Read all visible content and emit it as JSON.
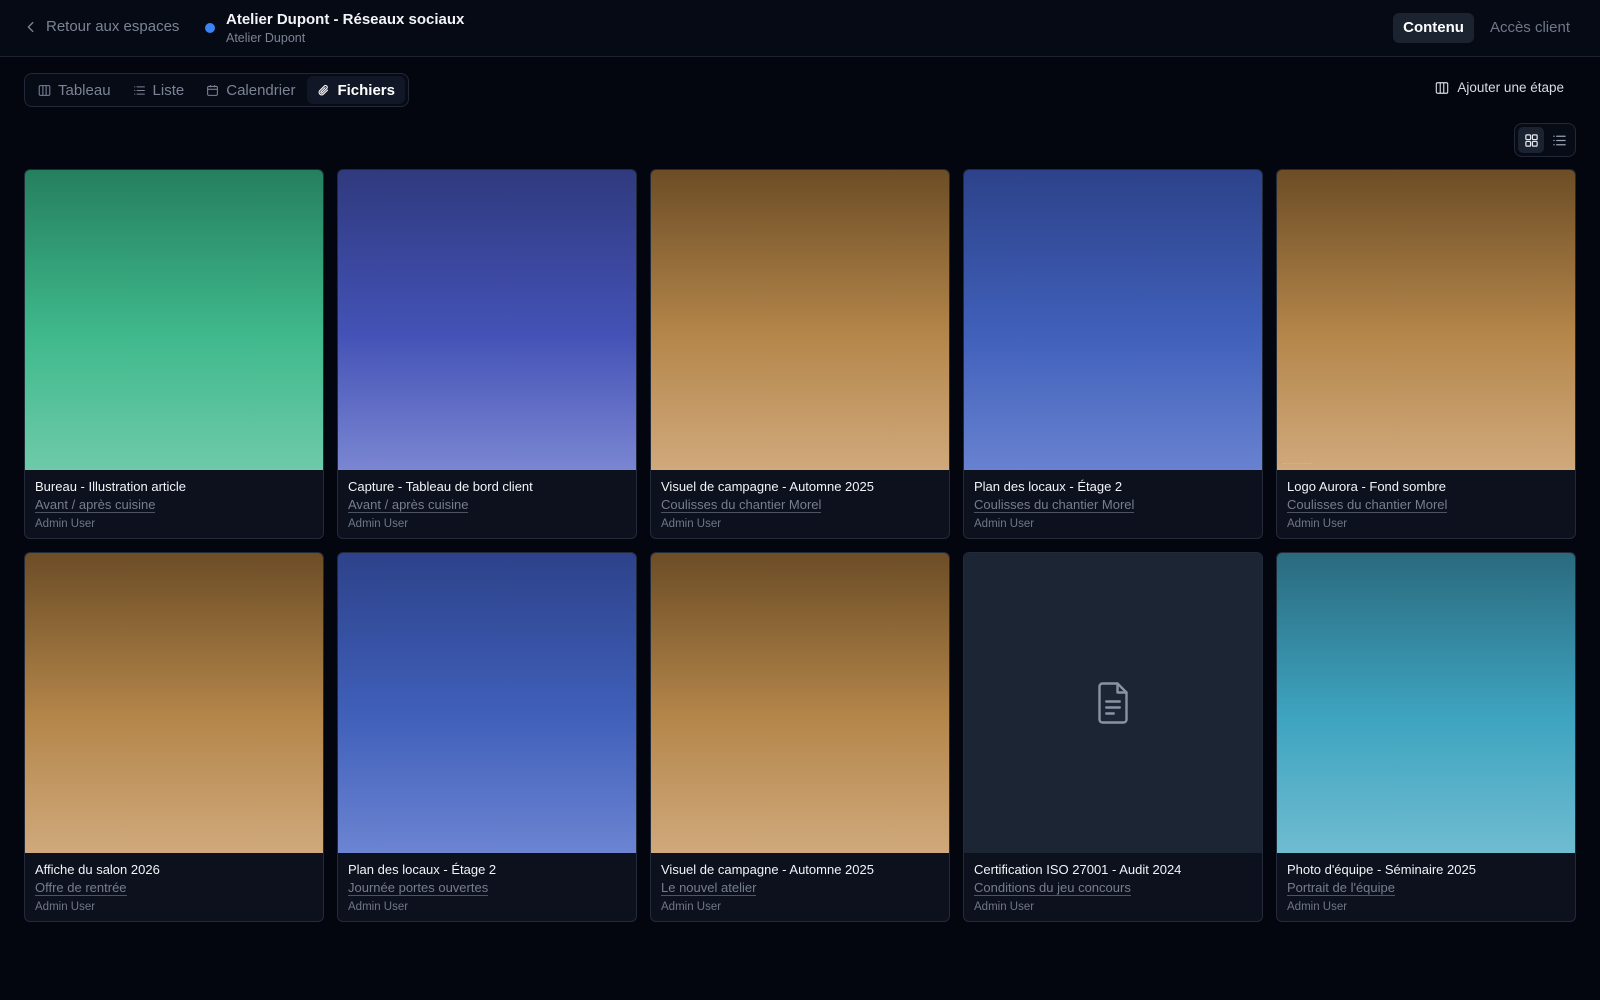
{
  "header": {
    "back_label": "Retour aux espaces",
    "space_title": "Atelier Dupont - Réseaux sociaux",
    "space_subtitle": "Atelier Dupont",
    "space_color": "#3b82f6",
    "modes": [
      {
        "label": "Contenu",
        "active": true
      },
      {
        "label": "Accès client",
        "active": false
      }
    ]
  },
  "tabs": [
    {
      "label": "Tableau",
      "icon": "columns-icon",
      "active": false
    },
    {
      "label": "Liste",
      "icon": "list-icon",
      "active": false
    },
    {
      "label": "Calendrier",
      "icon": "calendar-icon",
      "active": false
    },
    {
      "label": "Fichiers",
      "icon": "paperclip-icon",
      "active": true
    }
  ],
  "toolbar": {
    "add_step_label": "Ajouter une étape",
    "view_mode": "grid"
  },
  "files": [
    {
      "title": "Bureau - Illustration article",
      "step": "Avant / après cuisine",
      "author": "Admin User",
      "preview": "image",
      "gradient": [
        "#257f5e",
        "#3fb98c",
        "#6ecaa9"
      ]
    },
    {
      "title": "Capture - Tableau de bord client",
      "step": "Avant / après cuisine",
      "author": "Admin User",
      "preview": "image",
      "gradient": [
        "#2f3a7e",
        "#4452b6",
        "#7a86d2"
      ]
    },
    {
      "title": "Visuel de campagne - Automne 2025",
      "step": "Coulisses du chantier Morel",
      "author": "Admin User",
      "preview": "image",
      "gradient": [
        "#6c4d26",
        "#b4864a",
        "#d0a97c"
      ]
    },
    {
      "title": "Plan des locaux - Étage 2",
      "step": "Coulisses du chantier Morel",
      "author": "Admin User",
      "preview": "image",
      "gradient": [
        "#2d428a",
        "#4060ba",
        "#6882d0"
      ]
    },
    {
      "title": "Logo Aurora - Fond sombre",
      "step": "Coulisses du chantier Morel",
      "author": "Admin User",
      "preview": "image",
      "gradient": [
        "#6c4d26",
        "#b4864a",
        "#d0a97c"
      ],
      "watermark": true
    },
    {
      "title": "Affiche du salon 2026",
      "step": "Offre de rentrée",
      "author": "Admin User",
      "preview": "image",
      "gradient": [
        "#6c4d26",
        "#b4864a",
        "#d0a97c"
      ]
    },
    {
      "title": "Plan des locaux - Étage 2",
      "step": "Journée portes ouvertes",
      "author": "Admin User",
      "preview": "image",
      "gradient": [
        "#2d428a",
        "#4060ba",
        "#6c84d2"
      ]
    },
    {
      "title": "Visuel de campagne - Automne 2025",
      "step": "Le nouvel atelier",
      "author": "Admin User",
      "preview": "image",
      "gradient": [
        "#6c4d26",
        "#b4864a",
        "#d0a97c"
      ]
    },
    {
      "title": "Certification ISO 27001 - Audit 2024",
      "step": "Conditions du jeu concours",
      "author": "Admin User",
      "preview": "document",
      "icon": "file-text-icon"
    },
    {
      "title": "Photo d'équipe - Séminaire 2025",
      "step": "Portrait de l'équipe",
      "author": "Admin User",
      "preview": "image",
      "gradient": [
        "#2a6a7e",
        "#3ea4c0",
        "#6fbcd0"
      ]
    }
  ]
}
